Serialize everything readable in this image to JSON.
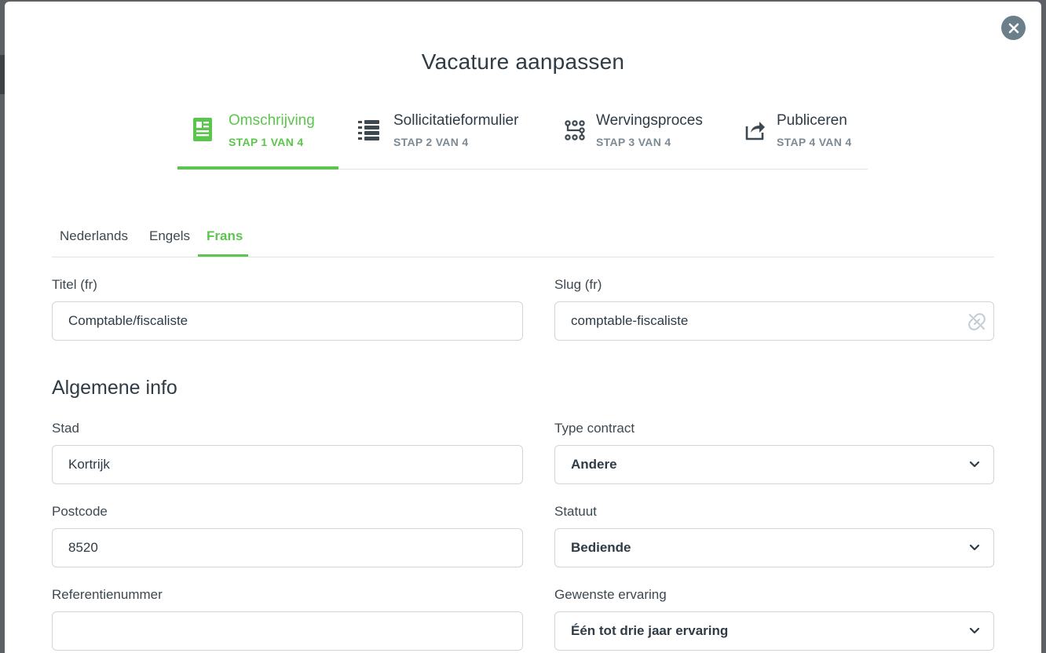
{
  "modal": {
    "title": "Vacature aanpassen",
    "close_icon": "close-icon"
  },
  "steps": [
    {
      "name": "Omschrijving",
      "sub": "STAP 1 VAN 4",
      "icon": "document-icon",
      "active": true
    },
    {
      "name": "Sollicitatieformulier",
      "sub": "STAP 2 VAN 4",
      "icon": "list-icon",
      "active": false
    },
    {
      "name": "Wervingsproces",
      "sub": "STAP 3 VAN 4",
      "icon": "flow-icon",
      "active": false
    },
    {
      "name": "Publiceren",
      "sub": "STAP 4 VAN 4",
      "icon": "share-icon",
      "active": false
    }
  ],
  "language_tabs": [
    {
      "label": "Nederlands",
      "active": false
    },
    {
      "label": "Engels",
      "active": false
    },
    {
      "label": "Frans",
      "active": true
    }
  ],
  "form": {
    "title": {
      "label": "Titel (fr)",
      "value": "Comptable/fiscaliste"
    },
    "slug": {
      "label": "Slug (fr)",
      "value": "comptable-fiscaliste",
      "icon": "link-off-icon"
    },
    "general_section_title": "Algemene info",
    "city": {
      "label": "Stad",
      "value": "Kortrijk"
    },
    "contract_type": {
      "label": "Type contract",
      "value": "Andere"
    },
    "postcode": {
      "label": "Postcode",
      "value": "8520"
    },
    "status": {
      "label": "Statuut",
      "value": "Bediende"
    },
    "reference": {
      "label": "Referentienummer",
      "value": ""
    },
    "experience": {
      "label": "Gewenste ervaring",
      "value": "Één tot drie jaar ervaring"
    }
  },
  "colors": {
    "accent": "#5cc54d",
    "text": "#2f3b45",
    "muted": "#7d8a94",
    "border": "#cfd6db",
    "close_button": "#6b7f8a"
  }
}
